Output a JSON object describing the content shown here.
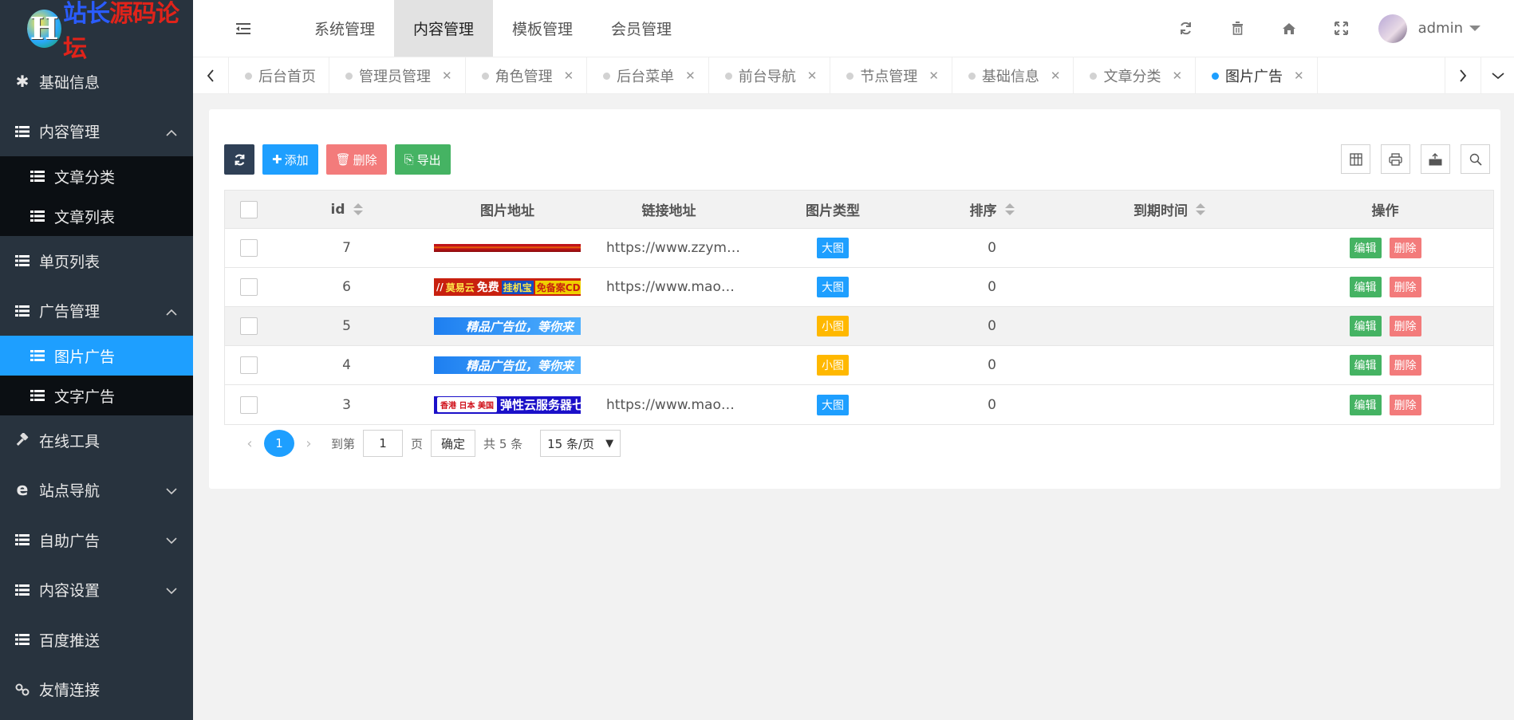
{
  "logo": {
    "letter": "H",
    "text_blue": "站长",
    "text_red": "源码论坛"
  },
  "sidebar": {
    "items": [
      {
        "label": "基础信息",
        "icon": "asterisk-icon"
      },
      {
        "label": "内容管理",
        "icon": "list-icon",
        "expanded": true,
        "children": [
          {
            "label": "文章分类"
          },
          {
            "label": "文章列表"
          }
        ]
      },
      {
        "label": "单页列表",
        "icon": "list-icon"
      },
      {
        "label": "广告管理",
        "icon": "list-icon",
        "expanded": true,
        "children": [
          {
            "label": "图片广告",
            "active": true
          },
          {
            "label": "文字广告"
          }
        ]
      },
      {
        "label": "在线工具",
        "icon": "gavel-icon"
      },
      {
        "label": "站点导航",
        "icon": "ie-icon"
      },
      {
        "label": "自助广告",
        "icon": "list-icon"
      },
      {
        "label": "内容设置",
        "icon": "list-icon"
      },
      {
        "label": "百度推送",
        "icon": "list-icon"
      },
      {
        "label": "友情连接",
        "icon": "link-icon"
      }
    ]
  },
  "header": {
    "top_nav": [
      "系统管理",
      "内容管理",
      "模板管理",
      "会员管理"
    ],
    "active_nav": "内容管理",
    "user": "admin"
  },
  "tabs": [
    {
      "label": "后台首页",
      "closable": false
    },
    {
      "label": "管理员管理",
      "closable": true
    },
    {
      "label": "角色管理",
      "closable": true
    },
    {
      "label": "后台菜单",
      "closable": true
    },
    {
      "label": "前台导航",
      "closable": true
    },
    {
      "label": "节点管理",
      "closable": true
    },
    {
      "label": "基础信息",
      "closable": true
    },
    {
      "label": "文章分类",
      "closable": true
    },
    {
      "label": "图片广告",
      "closable": true,
      "active": true
    }
  ],
  "toolbar": {
    "add": "添加",
    "delete": "删除",
    "export": "导出"
  },
  "table": {
    "headers": {
      "id": "id",
      "image": "图片地址",
      "link": "链接地址",
      "type": "图片类型",
      "sort": "排序",
      "expire": "到期时间",
      "ops": "操作"
    },
    "rows": [
      {
        "id": "7",
        "link": "https://www.zzymlt.com",
        "type": "大图",
        "type_kind": "big",
        "sort": "0",
        "expire": ""
      },
      {
        "id": "6",
        "link": "https://www.maokyun.com",
        "type": "大图",
        "type_kind": "big",
        "sort": "0",
        "expire": ""
      },
      {
        "id": "5",
        "link": "",
        "type": "小图",
        "type_kind": "small",
        "sort": "0",
        "expire": ""
      },
      {
        "id": "4",
        "link": "",
        "type": "小图",
        "type_kind": "small",
        "sort": "0",
        "expire": ""
      },
      {
        "id": "3",
        "link": "https://www.maokyun.com",
        "type": "大图",
        "type_kind": "big",
        "sort": "0",
        "expire": ""
      }
    ],
    "edit_label": "编辑",
    "delete_label": "删除"
  },
  "banners": {
    "b6_a": "莫易云",
    "b6_b": "免费",
    "b6_c": "挂机宝",
    "b6_d": "免备案CDN",
    "b5": "精品广告位，等你来",
    "b4": "精品广告位，等你来",
    "b3_tag": "香港 日本 美国",
    "b3_text": "弹性云服务器七"
  },
  "pager": {
    "current": "1",
    "goto_label": "到第",
    "goto_value": "1",
    "page_label": "页",
    "confirm": "确定",
    "total": "共 5 条",
    "per_page": "15 条/页"
  }
}
